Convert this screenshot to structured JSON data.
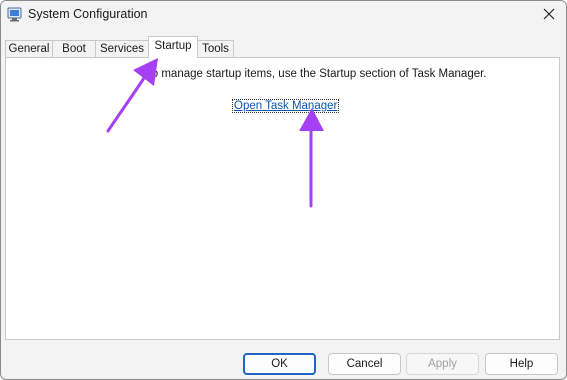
{
  "window": {
    "title": "System Configuration",
    "close_glyph": "✕"
  },
  "tabs": [
    {
      "label": "General",
      "active": false
    },
    {
      "label": "Boot",
      "active": false
    },
    {
      "label": "Services",
      "active": false
    },
    {
      "label": "Startup",
      "active": true
    },
    {
      "label": "Tools",
      "active": false
    }
  ],
  "startup": {
    "info_text": "To manage startup items, use the Startup section of Task Manager.",
    "link_text": "Open Task Manager"
  },
  "buttons": {
    "ok": "OK",
    "cancel": "Cancel",
    "apply": "Apply",
    "help": "Help"
  },
  "annotations": {
    "arrow_color": "#a640f5"
  },
  "icons": {
    "app": "system-config-icon",
    "close": "close-icon",
    "arrow": "purple-arrow"
  }
}
